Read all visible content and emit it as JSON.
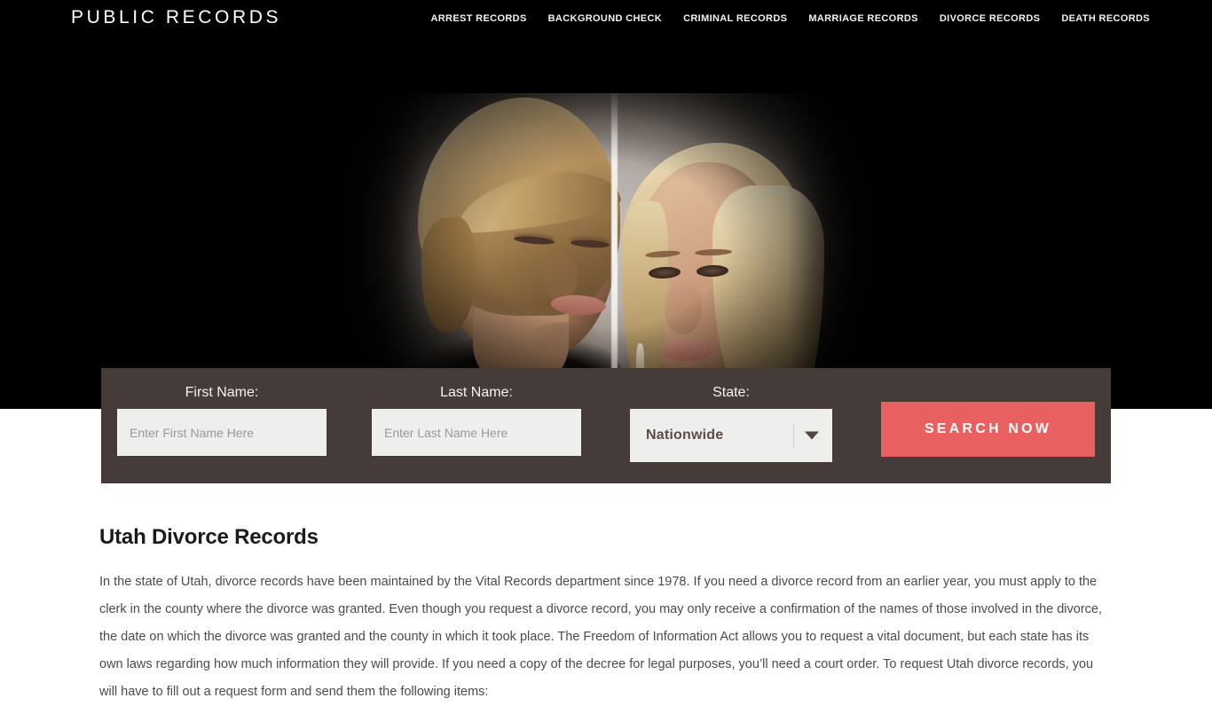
{
  "header": {
    "logo": "PUBLIC RECORDS",
    "nav": [
      {
        "label": "ARREST RECORDS"
      },
      {
        "label": "BACKGROUND CHECK"
      },
      {
        "label": "CRIMINAL RECORDS"
      },
      {
        "label": "MARRIAGE RECORDS"
      },
      {
        "label": "DIVORCE RECORDS"
      },
      {
        "label": "DEATH RECORDS"
      }
    ]
  },
  "hero": {
    "image_description": "Split portrait of an upset young couple back to back, dark vignette background"
  },
  "search_form": {
    "first_name": {
      "label": "First Name:",
      "placeholder": "Enter First Name Here",
      "value": ""
    },
    "last_name": {
      "label": "Last Name:",
      "placeholder": "Enter Last Name Here",
      "value": ""
    },
    "state": {
      "label": "State:",
      "selected": "Nationwide"
    },
    "submit_label": "SEARCH NOW"
  },
  "article": {
    "title": "Utah Divorce Records",
    "paragraph": "In the state of Utah, divorce records have been maintained by the Vital Records department since 1978. If you need a divorce record from an earlier year, you must apply to the clerk in the county where the divorce was granted. Even though you request a divorce record, you may only receive a confirmation of the names of those involved in the divorce, the date on which the divorce was granted and the county in which it took place. The Freedom of Information Act allows you to request a vital document, but each state has its own laws regarding how much information they will provide. If you need a copy of the decree for legal purposes, you’ll need a court order. To request Utah divorce records, you will have to fill out a request form and send them the following items:"
  },
  "colors": {
    "header_background": "#000000",
    "form_bar": "#453c3a",
    "button": "#e8605f",
    "input_background": "#eeeeec",
    "select_text": "#5d4b47",
    "body_text": "#4b4b4b"
  }
}
